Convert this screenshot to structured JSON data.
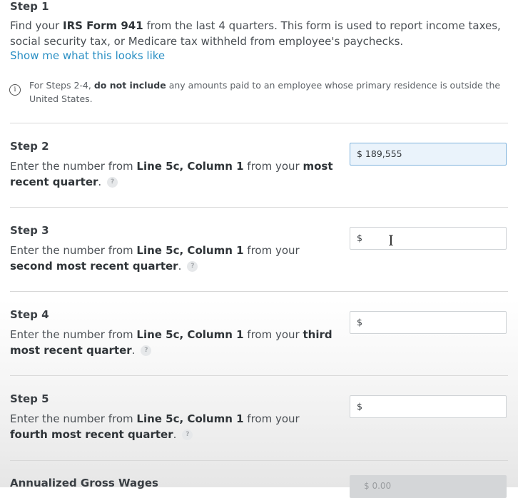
{
  "step1": {
    "title": "Step 1",
    "text_pre": "Find your ",
    "text_bold": "IRS Form 941",
    "text_post": " from the last 4 quarters. This form is used to report income taxes, social security tax, or Medicare tax withheld from employee's paychecks.",
    "link": "Show me what this looks like"
  },
  "note": {
    "icon": "info-icon",
    "pre": "For Steps 2-4, ",
    "bold": "do not include",
    "post": " any amounts paid to an employee whose primary residence is outside the United States."
  },
  "steps": [
    {
      "title": "Step 2",
      "pre": "Enter the number from ",
      "line": "Line 5c, Column 1",
      "mid": " from your ",
      "bold": "most recent quarter",
      "end": ".",
      "input_value": "$ 189,555"
    },
    {
      "title": "Step 3",
      "pre": "Enter the number from ",
      "line": "Line 5c, Column 1",
      "mid": " from your ",
      "bold": "second most recent quarter",
      "end": ".",
      "input_value": "$"
    },
    {
      "title": "Step 4",
      "pre": "Enter the number from ",
      "line": "Line 5c, Column 1",
      "mid": " from your ",
      "bold": "third most recent quarter",
      "end": ".",
      "input_value": "$"
    },
    {
      "title": "Step 5",
      "pre": "Enter the number from ",
      "line": "Line 5c, Column 1",
      "mid": " from your ",
      "bold": "fourth most recent quarter",
      "end": ".",
      "input_value": "$"
    }
  ],
  "help_glyph": "?",
  "annualized": {
    "title": "Annualized Gross Wages",
    "value": "$ 0.00"
  }
}
